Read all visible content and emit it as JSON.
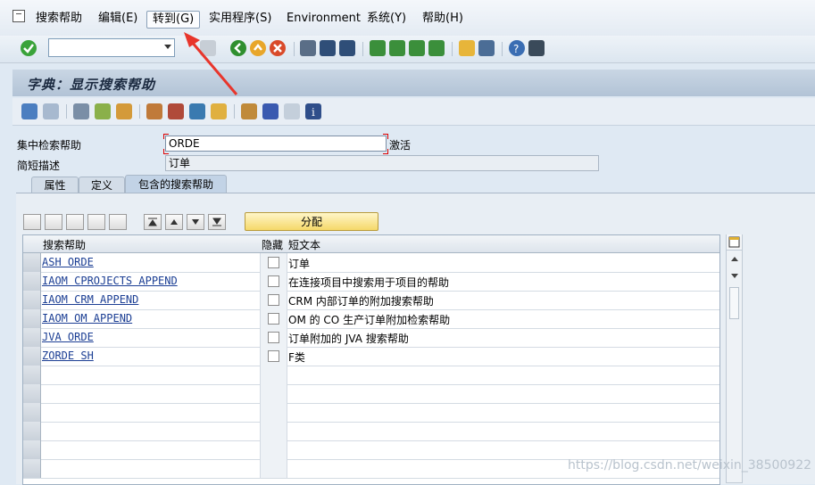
{
  "menu": {
    "items": [
      "搜索帮助",
      "编辑(E)",
      "转到(G)",
      "实用程序(S)",
      "Environment",
      "系统(Y)",
      "帮助(H)"
    ]
  },
  "toolbar": {
    "command_value": "",
    "icons": [
      "enter-icon",
      "save-icon",
      "back-icon",
      "exit-icon",
      "cancel-icon",
      "print-icon",
      "find-icon",
      "find-next-icon",
      "first-page-icon",
      "previous-page-icon",
      "next-page-icon",
      "last-page-icon",
      "create-session-icon",
      "shortcut-icon",
      "help-icon",
      "customize-layout-icon"
    ]
  },
  "screen": {
    "title": "字典：显示搜索帮助"
  },
  "form": {
    "collective_label": "集中检索帮助",
    "collective_value": "ORDE",
    "status": "激活",
    "short_desc_label": "简短描述",
    "short_desc_value": "订单"
  },
  "tabs": [
    "属性",
    "定义",
    "包含的搜索帮助"
  ],
  "active_tab": 2,
  "table": {
    "distribute_label": "分配",
    "headers": {
      "search_help": "搜索帮助",
      "hidden": "隐藏",
      "short_text": "短文本"
    },
    "rows": [
      {
        "name": "ASH ORDE",
        "hidden": false,
        "text": "订单"
      },
      {
        "name": "IAOM CPROJECTS APPEND",
        "hidden": false,
        "text": "在连接项目中搜索用于项目的帮助"
      },
      {
        "name": "IAOM CRM APPEND",
        "hidden": false,
        "text": "CRM 内部订单的附加搜索帮助"
      },
      {
        "name": "IAOM OM APPEND",
        "hidden": false,
        "text": "OM 的 CO 生产订单附加检索帮助"
      },
      {
        "name": "JVA ORDE",
        "hidden": false,
        "text": "订单附加的 JVA 搜索帮助"
      },
      {
        "name": "ZORDE SH",
        "hidden": false,
        "text": "F类"
      }
    ]
  },
  "watermark": "https://blog.csdn.net/weixin_38500922",
  "colors": {
    "accent_arrow": "#e8352b",
    "link": "#1c3f94",
    "distribute_button": "#f5d86a"
  }
}
